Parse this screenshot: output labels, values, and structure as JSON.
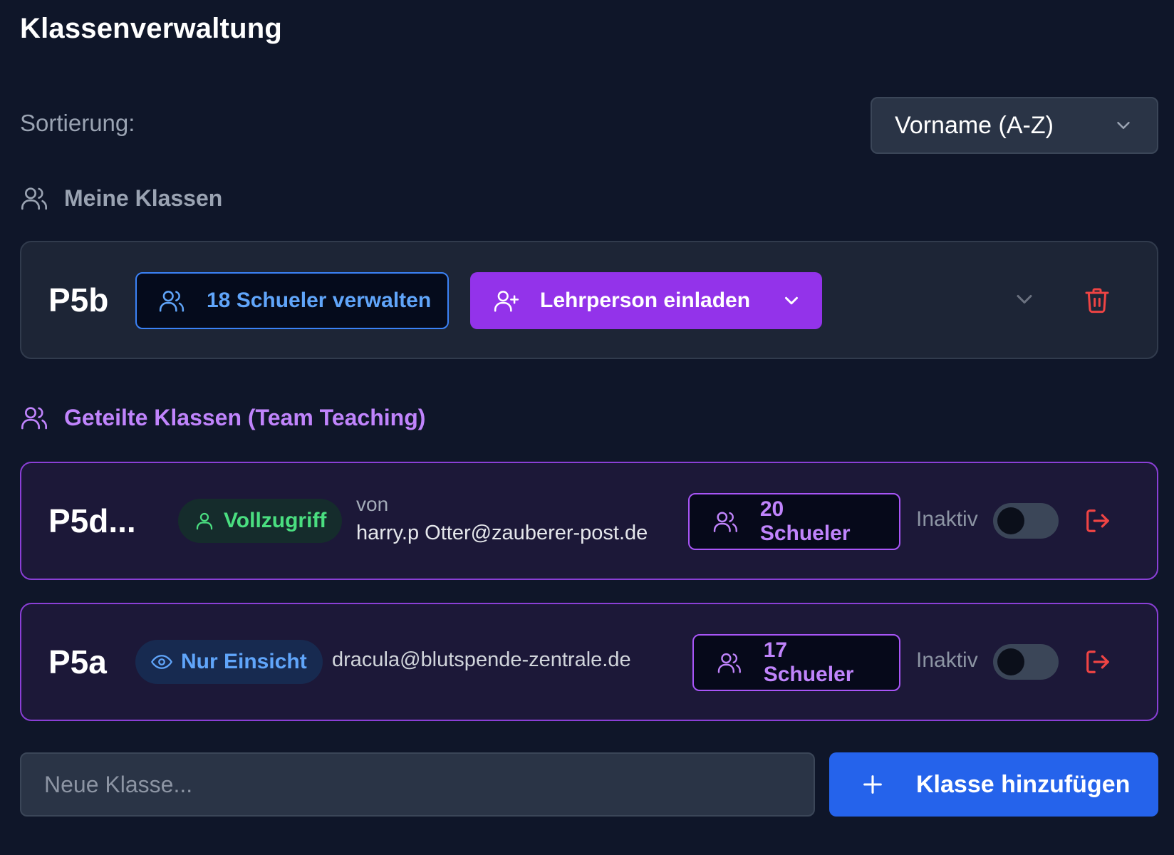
{
  "page": {
    "title": "Klassenverwaltung"
  },
  "sort": {
    "label": "Sortierung:",
    "selected": "Vorname (A-Z)"
  },
  "sections": {
    "mine": {
      "title": "Meine Klassen"
    },
    "shared": {
      "title": "Geteilte Klassen (Team Teaching)"
    }
  },
  "own_classes": [
    {
      "name": "P5b",
      "students_button": "18 Schueler verwalten",
      "invite_button": "Lehrperson einladen"
    }
  ],
  "shared_classes": [
    {
      "name": "P5d...",
      "access": "Vollzugriff",
      "owner_prefix": "von",
      "owner": "harry.p Otter@zauberer-post.de",
      "students": "20 Schueler",
      "status": "Inaktiv",
      "active": false
    },
    {
      "name": "P5a",
      "access": "Nur Einsicht",
      "owner": "dracula@blutspende-zentrale.de",
      "students": "17 Schueler",
      "status": "Inaktiv",
      "active": false
    }
  ],
  "new_class": {
    "placeholder": "Neue Klasse...",
    "add_label": "Klasse hinzufügen"
  },
  "colors": {
    "background": "#0f1629",
    "accent_blue": "#2563eb",
    "accent_purple": "#9333ea",
    "danger": "#ef4444",
    "success": "#4ade80"
  },
  "icons": {
    "users": "users-icon",
    "user_plus": "user-plus-icon",
    "chevron": "chevron-down-icon",
    "trash": "trash-icon",
    "eye": "eye-icon",
    "leave": "log-out-icon",
    "plus": "plus-icon"
  }
}
